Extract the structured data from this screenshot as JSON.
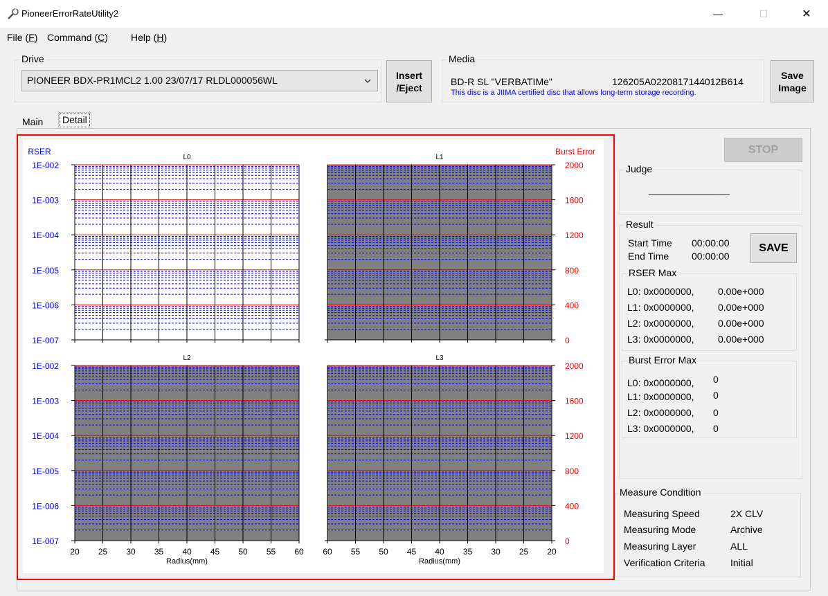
{
  "window": {
    "title": "PioneerErrorRateUtility2",
    "minimize_glyph": "—",
    "maximize_glyph": "☐",
    "close_glyph": "✕"
  },
  "menu": [
    {
      "label": "File (F)",
      "base": "File (",
      "key": "F",
      "tail": ")"
    },
    {
      "label": "Command (C)",
      "base": "Command (",
      "key": "C",
      "tail": ")"
    },
    {
      "label": "Help (H)",
      "base": "Help (",
      "key": "H",
      "tail": ")"
    }
  ],
  "drive": {
    "group_label": "Drive",
    "selected": "PIONEER BDX-PR1MCL2    1.00 23/07/17  RLDL000056WL",
    "insert_eject_label": "Insert\n/Eject"
  },
  "media": {
    "group_label": "Media",
    "disc_type": "BD-R SL \"VERBATIMe\"",
    "disc_id": "126205A0220817144012B614",
    "note": "This disc is a JIIMA certified disc that allows long-term storage recording.",
    "save_image_label": "Save\nImage"
  },
  "tabs": [
    {
      "label": "Main",
      "active": false
    },
    {
      "label": "Detail",
      "active": true
    }
  ],
  "chart_data": {
    "type": "line",
    "left_axis_label": "RSER",
    "right_axis_label": "Burst Error",
    "rser_ticks": [
      "1E-002",
      "1E-003",
      "1E-004",
      "1E-005",
      "1E-006",
      "1E-007"
    ],
    "burst_ticks": [
      "2000",
      "1600",
      "1200",
      "800",
      "400",
      "0"
    ],
    "xlabel": "Radius(mm)",
    "colors": {
      "rser_axis": "#0000ff",
      "burst_axis": "#ff0000",
      "no_data_fill": "#808080",
      "grid_major_h": "#ff0000",
      "grid_minor_h": "#0000ff",
      "grid_v": "#000000"
    },
    "panels": [
      {
        "name": "L0",
        "x_ticks": [
          "20",
          "25",
          "30",
          "35",
          "40",
          "45",
          "50",
          "55",
          "60"
        ],
        "xlim": [
          20,
          60
        ],
        "filled": false
      },
      {
        "name": "L1",
        "x_ticks": [
          "60",
          "55",
          "50",
          "45",
          "40",
          "35",
          "30",
          "25",
          "20"
        ],
        "xlim": [
          60,
          20
        ],
        "filled": true
      },
      {
        "name": "L2",
        "x_ticks": [
          "20",
          "25",
          "30",
          "35",
          "40",
          "45",
          "50",
          "55",
          "60"
        ],
        "xlim": [
          20,
          60
        ],
        "filled": true
      },
      {
        "name": "L3",
        "x_ticks": [
          "60",
          "55",
          "50",
          "45",
          "40",
          "35",
          "30",
          "25",
          "20"
        ],
        "xlim": [
          60,
          20
        ],
        "filled": true
      }
    ],
    "series": []
  },
  "side": {
    "stop_label": "STOP",
    "judge_label": "Judge",
    "judge_value": "_______________",
    "result_label": "Result",
    "start_time_label": "Start Time",
    "start_time_value": "00:00:00",
    "end_time_label": "End Time",
    "end_time_value": "00:00:00",
    "save_label": "SAVE",
    "rser_max_label": "RSER Max",
    "rser_max": [
      {
        "addr": "L0: 0x0000000,",
        "value": "0.00e+000"
      },
      {
        "addr": "L1: 0x0000000,",
        "value": "0.00e+000"
      },
      {
        "addr": "L2: 0x0000000,",
        "value": "0.00e+000"
      },
      {
        "addr": "L3: 0x0000000,",
        "value": "0.00e+000"
      }
    ],
    "burst_max_label": "Burst Error Max",
    "burst_max": [
      {
        "addr": "L0: 0x0000000,",
        "value": "0"
      },
      {
        "addr": "L1: 0x0000000,",
        "value": "0"
      },
      {
        "addr": "L2: 0x0000000,",
        "value": "0"
      },
      {
        "addr": "L3: 0x0000000,",
        "value": "0"
      }
    ],
    "measure_label": "Measure Condition",
    "measure": [
      {
        "label": "Measuring Speed",
        "value": "2X CLV"
      },
      {
        "label": "Measuring Mode",
        "value": "Archive"
      },
      {
        "label": "Measuring Layer",
        "value": "ALL"
      },
      {
        "label": "Verification Criteria",
        "value": "Initial"
      }
    ]
  }
}
